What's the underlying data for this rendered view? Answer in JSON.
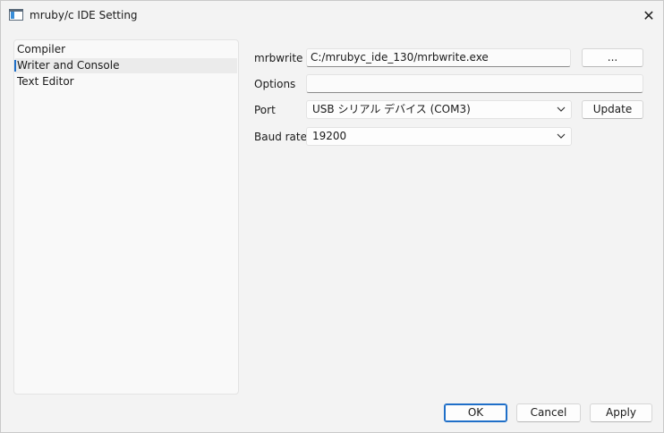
{
  "window": {
    "title": "mruby/c IDE Setting",
    "close_glyph": "✕"
  },
  "sidebar": {
    "items": [
      {
        "label": "Compiler",
        "selected": false
      },
      {
        "label": "Writer and Console",
        "selected": true
      },
      {
        "label": "Text Editor",
        "selected": false
      }
    ]
  },
  "form": {
    "mrbwrite_label": "mrbwrite",
    "mrbwrite_value": "C:/mrubyc_ide_130/mrbwrite.exe",
    "browse_label": "...",
    "options_label": "Options",
    "options_value": "",
    "port_label": "Port",
    "port_value": "USB シリアル デバイス (COM3)",
    "update_label": "Update",
    "baud_label": "Baud rate",
    "baud_value": "19200"
  },
  "footer": {
    "ok_label": "OK",
    "cancel_label": "Cancel",
    "apply_label": "Apply"
  },
  "colors": {
    "accent": "#1f6fc8",
    "background": "#f3f3f3"
  },
  "icons": {
    "app": "app-window-icon",
    "close": "close-icon",
    "dropdown": "chevron-down-icon"
  }
}
